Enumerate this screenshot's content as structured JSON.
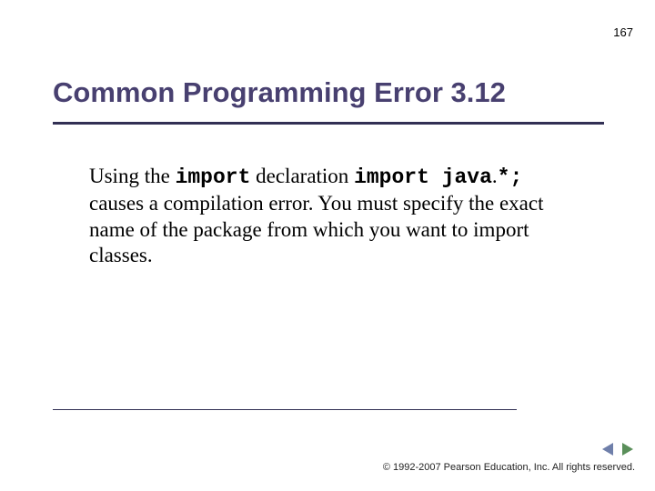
{
  "page_number": "167",
  "title": "Common Programming Error 3.12",
  "body": {
    "pre1": "Using the ",
    "code1": "import",
    "mid1": " declaration ",
    "code2": "import java",
    "dot": ".",
    "code3": "*;",
    "post": " causes a compilation error. You must specify the exact name of the package from which you want to import classes."
  },
  "copyright": "© 1992-2007 Pearson Education, Inc.  All rights reserved.",
  "nav": {
    "prev_color": "#6f7faa",
    "next_color": "#5a8f5a"
  }
}
